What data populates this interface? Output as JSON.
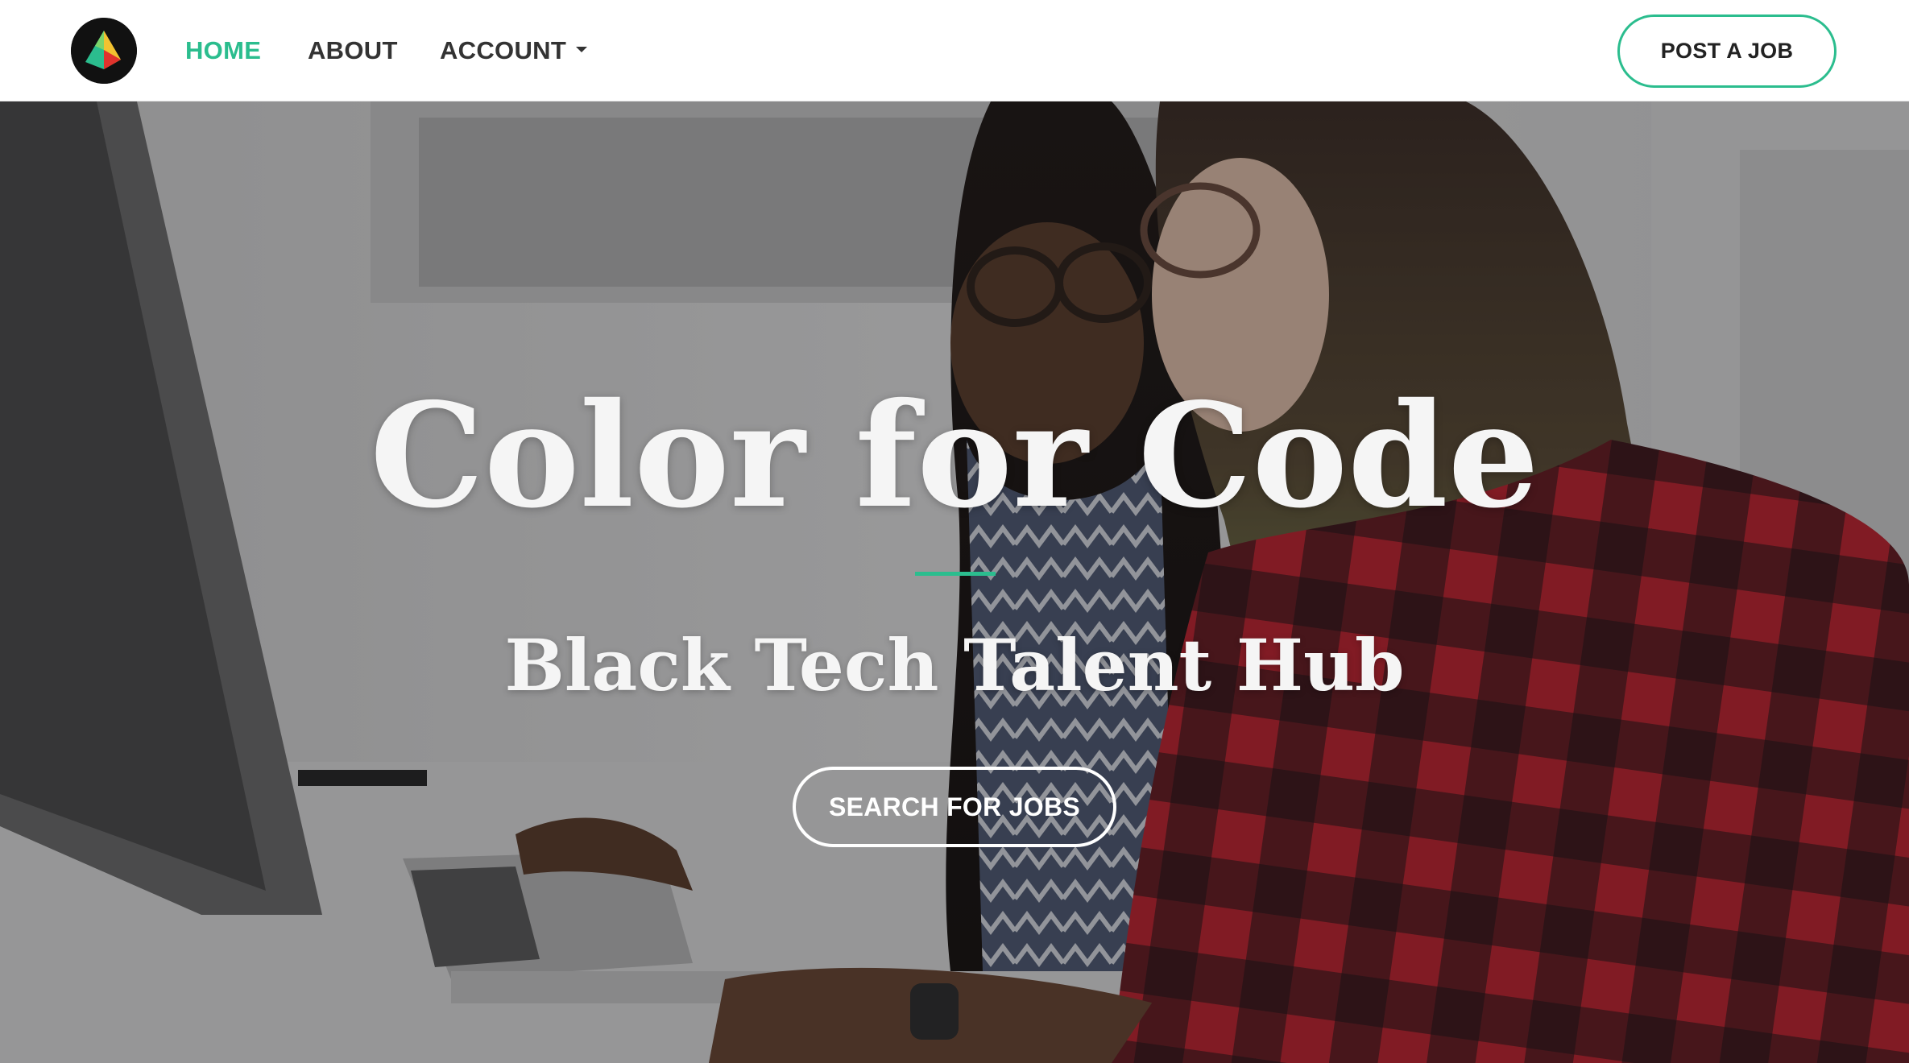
{
  "navbar": {
    "logo_icon": "pyramid-logo-icon",
    "links": {
      "home": "HOME",
      "about": "ABOUT",
      "account": "ACCOUNT"
    },
    "active_link": "HOME",
    "account_dropdown_icon": "caret-down-icon",
    "post_job_label": "POST A JOB"
  },
  "hero": {
    "background_image": "two-women-working-at-computer-photo",
    "title": "Color for Code",
    "subtitle": "Black Tech Talent Hub",
    "cta_label": "SEARCH FOR JOBS"
  },
  "colors": {
    "accent": "#2bbd8e",
    "nav_text": "#333333",
    "hero_text": "#f5f5f5"
  }
}
